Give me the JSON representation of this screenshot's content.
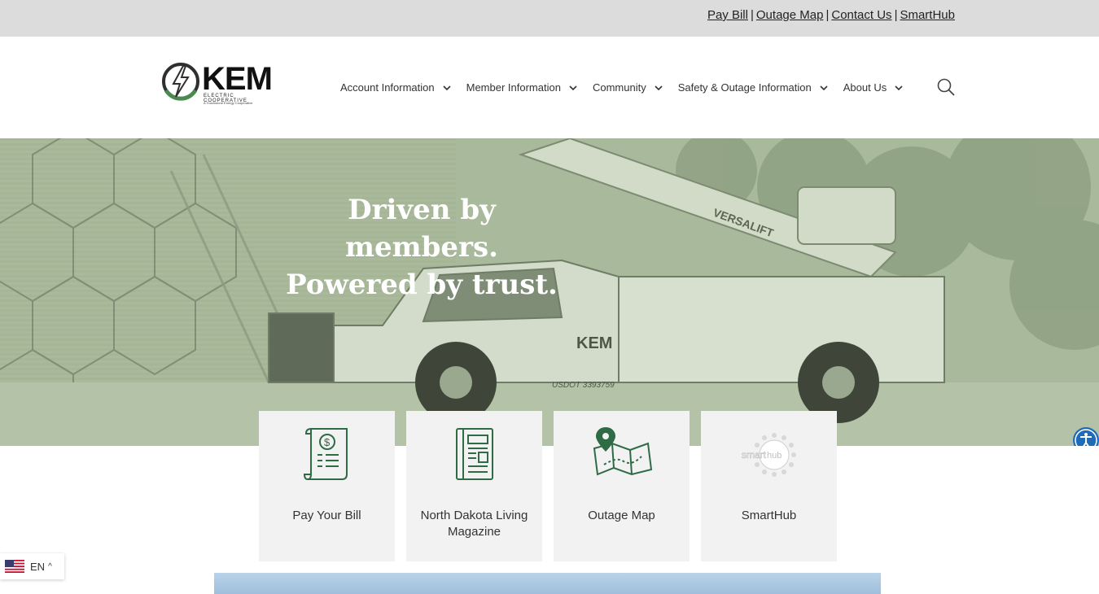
{
  "topbar": {
    "links": [
      "Pay Bill",
      "Outage Map",
      "Contact Us",
      "SmartHub"
    ],
    "separator": "|"
  },
  "header": {
    "logo": {
      "word": "KEM",
      "sub": "ELECTRIC COOPERATIVE",
      "tag": "A Touchstone Energy Cooperative"
    },
    "nav": [
      {
        "label": "Account Information",
        "icon": "chevron-down-icon"
      },
      {
        "label": "Member Information",
        "icon": "chevron-down-icon"
      },
      {
        "label": "Community",
        "icon": "chevron-down-icon"
      },
      {
        "label": "Safety & Outage Information",
        "icon": "chevron-down-icon"
      },
      {
        "label": "About Us",
        "icon": "chevron-down-icon"
      }
    ],
    "search_icon": "search-icon"
  },
  "hero": {
    "line1": "Driven by members.",
    "line2": "Powered by trust.",
    "truck_text": "KEM",
    "truck_dot": "USDOT 3393759",
    "boom_text": "VERSALIFT",
    "overlay_color": "#a9b99b"
  },
  "cards": [
    {
      "label": "Pay Your Bill",
      "icon": "bill-icon"
    },
    {
      "label": "North Dakota Living Magazine",
      "icon": "magazine-icon"
    },
    {
      "label": "Outage Map",
      "icon": "map-icon"
    },
    {
      "label": "SmartHub",
      "icon": "smarthub-icon"
    }
  ],
  "smarthub": {
    "left": "smart",
    "right": "hub"
  },
  "language": {
    "code": "EN",
    "caret": "^",
    "flag": "us-flag-icon"
  },
  "colors": {
    "accent_green": "#2f6b45",
    "topbar_bg": "#dcdcdc",
    "card_bg": "#f2f2f2",
    "a11y_blue": "#1e6bb8"
  }
}
